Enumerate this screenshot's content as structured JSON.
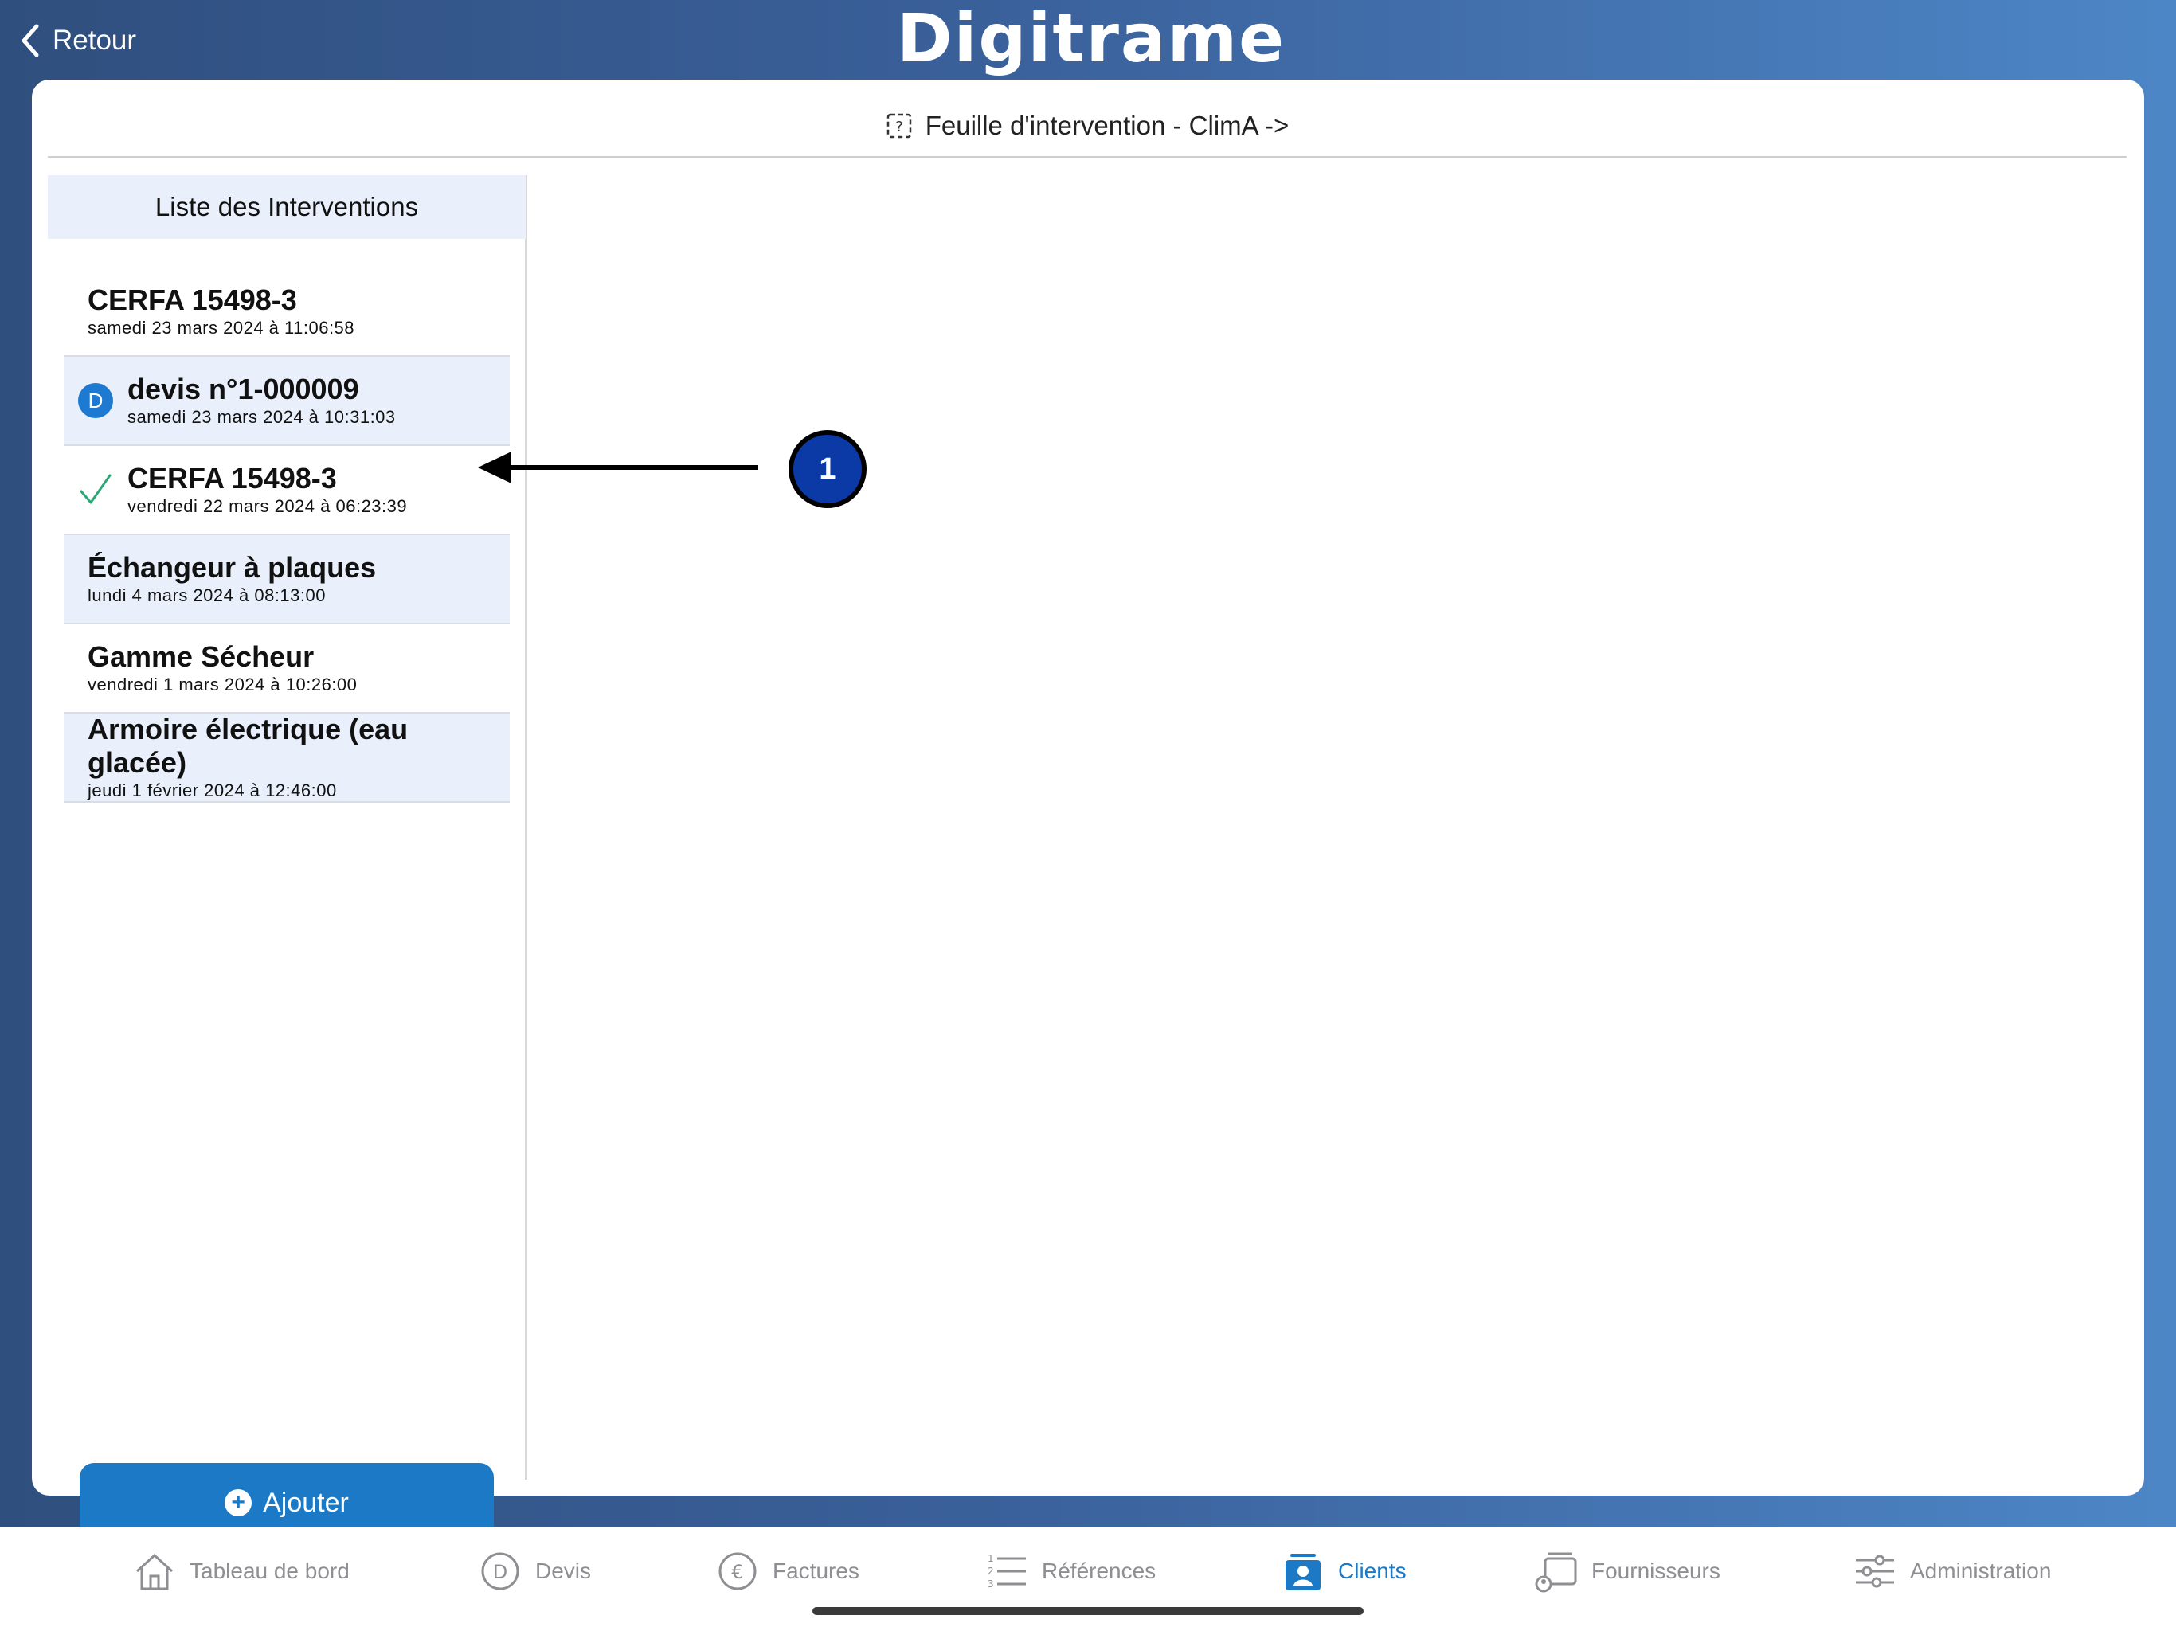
{
  "header": {
    "back_label": "Retour",
    "logo_text": "Digitrame"
  },
  "card": {
    "title": "Feuille d'intervention - ClimA ->"
  },
  "list": {
    "header": "Liste des Interventions",
    "items": [
      {
        "title": "CERFA 15498-3",
        "date": "samedi 23 mars 2024 à 11:06:58",
        "lead": "none"
      },
      {
        "title": "devis n°1-000009",
        "date": "samedi 23 mars 2024 à 10:31:03",
        "lead": "D"
      },
      {
        "title": "CERFA 15498-3",
        "date": "vendredi 22 mars 2024 à 06:23:39",
        "lead": "check"
      },
      {
        "title": "Échangeur à plaques",
        "date": "lundi 4 mars 2024 à 08:13:00",
        "lead": "none"
      },
      {
        "title": "Gamme Sécheur",
        "date": "vendredi 1 mars 2024 à 10:26:00",
        "lead": "none"
      },
      {
        "title": "Armoire électrique (eau glacée)",
        "date": "jeudi 1 février 2024 à 12:46:00",
        "lead": "none"
      }
    ],
    "add_label": "Ajouter"
  },
  "annotation": {
    "label": "1"
  },
  "tabs": [
    {
      "label": "Tableau de bord",
      "icon": "house-icon",
      "active": false
    },
    {
      "label": "Devis",
      "icon": "devis-icon",
      "active": false
    },
    {
      "label": "Factures",
      "icon": "euro-icon",
      "active": false
    },
    {
      "label": "Références",
      "icon": "numbered-list-icon",
      "active": false
    },
    {
      "label": "Clients",
      "icon": "client-icon",
      "active": true
    },
    {
      "label": "Fournisseurs",
      "icon": "supplier-icon",
      "active": false
    },
    {
      "label": "Administration",
      "icon": "sliders-icon",
      "active": false
    }
  ],
  "colors": {
    "accent": "#1b79c6",
    "highlight_row": "#e9f0fb",
    "check": "#2aa876",
    "annotation": "#0b3aa6"
  }
}
